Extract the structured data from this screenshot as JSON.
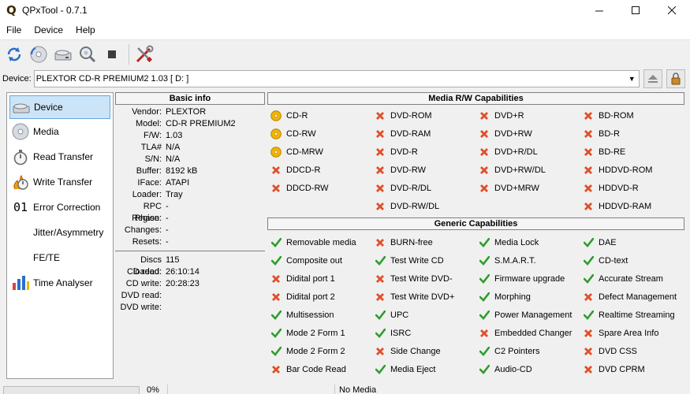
{
  "window": {
    "title": "QPxTool - 0.7.1",
    "app_icon": "Q"
  },
  "menu": [
    "File",
    "Device",
    "Help"
  ],
  "toolbar": [
    "refresh-icon",
    "cd-eject-icon",
    "drive-icon",
    "magnifier-icon",
    "stop-icon",
    "tools-icon"
  ],
  "device": {
    "label": "Device:",
    "value": "PLEXTOR  CD-R   PREMIUM2  1.03 [ D: ]"
  },
  "nav": [
    {
      "label": "Device",
      "icon": "drive-icon",
      "active": true
    },
    {
      "label": "Media",
      "icon": "disc-icon"
    },
    {
      "label": "Read Transfer",
      "icon": "stopwatch-icon"
    },
    {
      "label": "Write Transfer",
      "icon": "flame-stopwatch-icon"
    },
    {
      "label": "Error Correction",
      "icon": "01-icon",
      "glyph": "01"
    },
    {
      "label": "Jitter/Asymmetry",
      "icon": ""
    },
    {
      "label": "FE/TE",
      "icon": ""
    },
    {
      "label": "Time Analyser",
      "icon": "bar-chart-icon"
    }
  ],
  "basic_info": {
    "heading": "Basic info",
    "fields": [
      {
        "k": "Vendor:",
        "v": "PLEXTOR"
      },
      {
        "k": "Model:",
        "v": "CD-R   PREMIUM2"
      },
      {
        "k": "F/W:",
        "v": "1.03"
      },
      {
        "k": "TLA#",
        "v": "N/A"
      },
      {
        "k": "S/N:",
        "v": "N/A"
      },
      {
        "k": "Buffer:",
        "v": "8192 kB"
      },
      {
        "k": "IFace:",
        "v": "ATAPI"
      },
      {
        "k": "Loader:",
        "v": "Tray"
      },
      {
        "k": "RPC Phase:",
        "v": "-"
      },
      {
        "k": "Region:",
        "v": "-"
      },
      {
        "k": "Changes:",
        "v": "-"
      },
      {
        "k": "Resets:",
        "v": "-"
      }
    ],
    "stats": [
      {
        "k": "Discs loaded:",
        "v": "115"
      },
      {
        "k": "CD read:",
        "v": "26:10:14"
      },
      {
        "k": "CD write:",
        "v": "20:28:23"
      },
      {
        "k": "DVD read:",
        "v": ""
      },
      {
        "k": "DVD write:",
        "v": ""
      }
    ]
  },
  "media_caps": {
    "heading": "Media R/W Capabilities",
    "cells": [
      {
        "label": "CD-R",
        "status": "media"
      },
      {
        "label": "DVD-ROM",
        "status": "no"
      },
      {
        "label": "DVD+R",
        "status": "no"
      },
      {
        "label": "BD-ROM",
        "status": "no"
      },
      {
        "label": "CD-RW",
        "status": "media"
      },
      {
        "label": "DVD-RAM",
        "status": "no"
      },
      {
        "label": "DVD+RW",
        "status": "no"
      },
      {
        "label": "BD-R",
        "status": "no"
      },
      {
        "label": "CD-MRW",
        "status": "media"
      },
      {
        "label": "DVD-R",
        "status": "no"
      },
      {
        "label": "DVD+R/DL",
        "status": "no"
      },
      {
        "label": "BD-RE",
        "status": "no"
      },
      {
        "label": "DDCD-R",
        "status": "no"
      },
      {
        "label": "DVD-RW",
        "status": "no"
      },
      {
        "label": "DVD+RW/DL",
        "status": "no"
      },
      {
        "label": "HDDVD-ROM",
        "status": "no"
      },
      {
        "label": "DDCD-RW",
        "status": "no"
      },
      {
        "label": "DVD-R/DL",
        "status": "no"
      },
      {
        "label": "DVD+MRW",
        "status": "no"
      },
      {
        "label": "HDDVD-R",
        "status": "no"
      },
      {
        "label": "",
        "status": ""
      },
      {
        "label": "DVD-RW/DL",
        "status": "no"
      },
      {
        "label": "",
        "status": ""
      },
      {
        "label": "HDDVD-RAM",
        "status": "no"
      }
    ]
  },
  "generic_caps": {
    "heading": "Generic Capabilities",
    "cells": [
      {
        "label": "Removable media",
        "status": "yes"
      },
      {
        "label": "BURN-free",
        "status": "no"
      },
      {
        "label": "Media Lock",
        "status": "yes"
      },
      {
        "label": "DAE",
        "status": "yes"
      },
      {
        "label": "Composite out",
        "status": "yes"
      },
      {
        "label": "Test Write CD",
        "status": "yes"
      },
      {
        "label": "S.M.A.R.T.",
        "status": "yes"
      },
      {
        "label": "CD-text",
        "status": "yes"
      },
      {
        "label": "Didital port 1",
        "status": "no"
      },
      {
        "label": "Test Write DVD-",
        "status": "no"
      },
      {
        "label": "Firmware upgrade",
        "status": "yes"
      },
      {
        "label": "Accurate Stream",
        "status": "yes"
      },
      {
        "label": "Didital port 2",
        "status": "no"
      },
      {
        "label": "Test Write DVD+",
        "status": "no"
      },
      {
        "label": "Morphing",
        "status": "yes"
      },
      {
        "label": "Defect Management",
        "status": "no"
      },
      {
        "label": "Multisession",
        "status": "yes"
      },
      {
        "label": "UPC",
        "status": "yes"
      },
      {
        "label": "Power Management",
        "status": "yes"
      },
      {
        "label": "Realtime Streaming",
        "status": "yes"
      },
      {
        "label": "Mode 2 Form 1",
        "status": "yes"
      },
      {
        "label": "ISRC",
        "status": "yes"
      },
      {
        "label": "Embedded Changer",
        "status": "no"
      },
      {
        "label": "Spare Area Info",
        "status": "no"
      },
      {
        "label": "Mode 2 Form 2",
        "status": "yes"
      },
      {
        "label": "Side Change",
        "status": "no"
      },
      {
        "label": "C2 Pointers",
        "status": "yes"
      },
      {
        "label": "DVD CSS",
        "status": "no"
      },
      {
        "label": "Bar Code Read",
        "status": "no"
      },
      {
        "label": "Media Eject",
        "status": "yes"
      },
      {
        "label": "Audio-CD",
        "status": "yes"
      },
      {
        "label": "DVD CPRM",
        "status": "no"
      }
    ]
  },
  "status": {
    "progress": "0%",
    "progress_value": 0,
    "media": "No Media"
  },
  "colors": {
    "yes": "#2e9e2e",
    "no": "#e0502a",
    "media": "#f2b400",
    "accent": "#cce4f7"
  }
}
